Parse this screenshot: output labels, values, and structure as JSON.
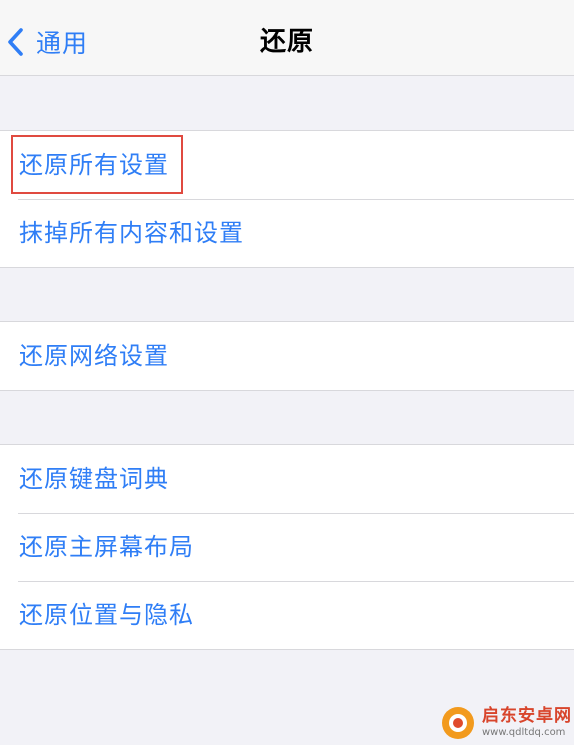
{
  "nav": {
    "back_label": "通用",
    "title": "还原"
  },
  "groups": [
    {
      "items": [
        {
          "label": "还原所有设置",
          "highlighted": true
        },
        {
          "label": "抹掉所有内容和设置"
        }
      ]
    },
    {
      "items": [
        {
          "label": "还原网络设置"
        }
      ]
    },
    {
      "items": [
        {
          "label": "还原键盘词典"
        },
        {
          "label": "还原主屏幕布局"
        },
        {
          "label": "还原位置与隐私"
        }
      ]
    }
  ],
  "watermark": {
    "name": "启东安卓网",
    "url": "www.qdltdq.com"
  },
  "colors": {
    "accent": "#2f7ef6",
    "highlight": "#e04a40",
    "background": "#f2f2f7"
  },
  "icons": {
    "back": "chevron-left-icon"
  }
}
